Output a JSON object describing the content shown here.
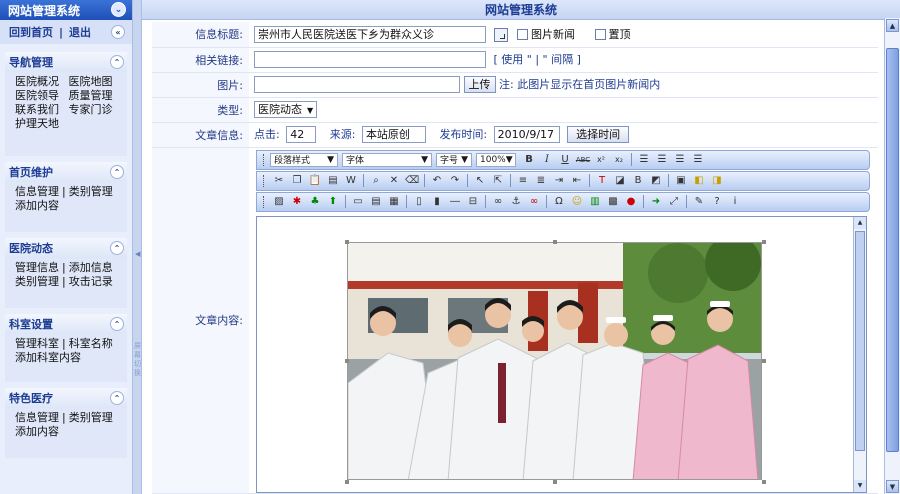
{
  "sidebar": {
    "title": "网站管理系统",
    "home": "回到首页",
    "logout": "退出",
    "groups": [
      {
        "title": "导航管理",
        "rows": [
          [
            "医院概况",
            "医院地图"
          ],
          [
            "医院领导",
            "质量管理"
          ],
          [
            "联系我们",
            "专家门诊"
          ],
          [
            "护理天地"
          ]
        ]
      },
      {
        "title": "首页维护",
        "rows": [
          [
            "信息管理",
            "类别管理"
          ],
          [
            "添加内容"
          ]
        ]
      },
      {
        "title": "医院动态",
        "rows": [
          [
            "管理信息",
            "添加信息"
          ],
          [
            "类别管理",
            "攻击记录"
          ]
        ]
      },
      {
        "title": "科室设置",
        "rows": [
          [
            "管理科室",
            "科室名称"
          ],
          [
            "添加科室内容"
          ]
        ]
      },
      {
        "title": "特色医疗",
        "rows": [
          [
            "信息管理",
            "类别管理"
          ],
          [
            "添加内容"
          ]
        ]
      }
    ],
    "splitter_text": "屏幕切换"
  },
  "header": {
    "title": "网站管理系统"
  },
  "form": {
    "title_label": "信息标题:",
    "title_value": "崇州市人民医院送医下乡为群众义诊",
    "pic_news": "图片新闻",
    "top": "置顶",
    "link_label": "相关链接:",
    "link_hint": "[ 使用 \" | \" 间隔 ]",
    "image_label": "图片:",
    "upload": "上传",
    "image_note": "注: 此图片显示在首页图片新闻内",
    "type_label": "类型:",
    "type_value": "医院动态",
    "info_label": "文章信息:",
    "clicks_label": "点击:",
    "clicks_value": "42",
    "source_label": "来源:",
    "source_value": "本站原创",
    "pubtime_label": "发布时间:",
    "pubtime_value": "2010/9/17",
    "choose_time": "选择时间",
    "content_label": "文章内容:"
  },
  "editor": {
    "style": "段落样式",
    "font": "字体",
    "size": "字号",
    "zoom": "100%"
  }
}
